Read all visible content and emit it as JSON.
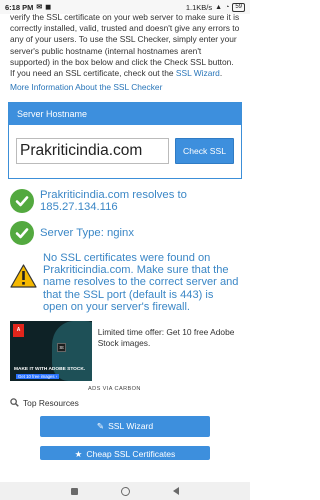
{
  "status_bar": {
    "time": "6:18 PM",
    "network_speed": "1.1KB/s",
    "battery": "59"
  },
  "intro": {
    "text": "verify the SSL certificate on your web server to make sure it is correctly installed, valid, trusted and doesn't give any errors to any of your users. To use the SSL Checker, simply enter your server's public hostname (internal hostnames aren't supported) in the box below and click the Check SSL button. If you need an SSL certificate, check out the ",
    "link": "SSL Wizard",
    "end": ".",
    "more_link": "More Information About the SSL Checker"
  },
  "checker": {
    "header": "Server Hostname",
    "hostname_value": "Prakriticindia.com",
    "button_label": "Check SSL"
  },
  "results": {
    "resolves": "Prakriticindia.com resolves to 185.27.134.116",
    "server_type": "Server Type: nginx",
    "warning": "No SSL certificates were found on Prakriticindia.com. Make sure that the name resolves to the correct server and that the SSL port (default is 443) is open on your server's firewall."
  },
  "ad": {
    "logo_text": "A",
    "image_badge": "St",
    "image_caption": "MAKE IT WITH ADOBE STOCK.",
    "image_cta": "Get 10 free images ›",
    "text": "Limited time offer: Get 10 free Adobe Stock images.",
    "via": "ADS VIA CARBON"
  },
  "resources": {
    "heading": "Top Resources",
    "buttons": [
      "SSL Wizard",
      "Cheap SSL Certificates"
    ]
  },
  "colors": {
    "accent": "#3d8fdd",
    "success": "#53a93f",
    "warning": "#f5b800",
    "link": "#2a76b9"
  }
}
